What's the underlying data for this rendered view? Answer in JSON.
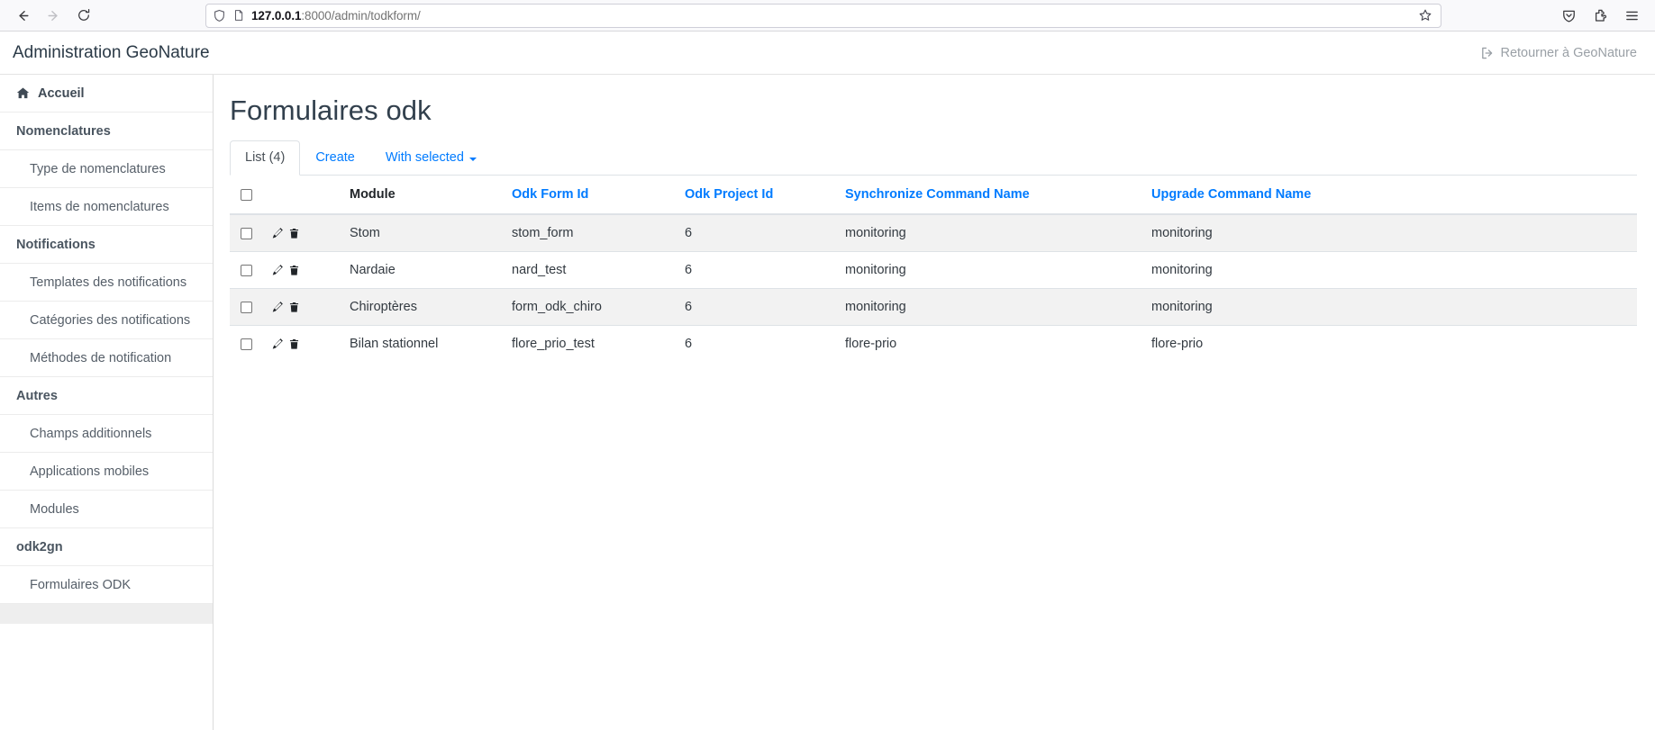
{
  "browser": {
    "back_icon": "arrow-left-icon",
    "forward_icon": "arrow-right-icon",
    "reload_icon": "reload-icon",
    "shield_icon": "shield-icon",
    "page_icon": "page-document-icon",
    "url_host": "127.0.0.1",
    "url_rest": ":8000/admin/todkform/",
    "url_full": "127.0.0.1:8000/admin/todkform/",
    "bookmark_icon": "star-icon",
    "right_icons": [
      "pocket-save-icon",
      "extensions-puzzle-icon",
      "app-menu-hamburger-icon"
    ]
  },
  "app_header": {
    "title": "Administration GeoNature",
    "return_label": "Retourner à GeoNature",
    "return_icon": "sign-out-icon"
  },
  "sidebar": {
    "items": [
      {
        "label": "Accueil",
        "type": "home",
        "icon": "home-icon"
      },
      {
        "label": "Nomenclatures",
        "type": "group"
      },
      {
        "label": "Type de nomenclatures",
        "type": "child"
      },
      {
        "label": "Items de nomenclatures",
        "type": "child"
      },
      {
        "label": "Notifications",
        "type": "group"
      },
      {
        "label": "Templates des notifications",
        "type": "child"
      },
      {
        "label": "Catégories des notifications",
        "type": "child"
      },
      {
        "label": "Méthodes de notification",
        "type": "child"
      },
      {
        "label": "Autres",
        "type": "group"
      },
      {
        "label": "Champs additionnels",
        "type": "child"
      },
      {
        "label": "Applications mobiles",
        "type": "child"
      },
      {
        "label": "Modules",
        "type": "child"
      },
      {
        "label": "odk2gn",
        "type": "group"
      },
      {
        "label": "Formulaires ODK",
        "type": "child"
      }
    ]
  },
  "main": {
    "page_title": "Formulaires odk",
    "tabs": [
      {
        "label": "List (4)",
        "active": true,
        "caret": false
      },
      {
        "label": "Create",
        "active": false,
        "caret": false
      },
      {
        "label": "With selected",
        "active": false,
        "caret": true
      }
    ],
    "table": {
      "select_all_icon": "checkbox-unchecked",
      "columns": [
        {
          "label": "",
          "key": "check"
        },
        {
          "label": "",
          "key": "ops"
        },
        {
          "label": "Module",
          "key": "module",
          "sortable": false
        },
        {
          "label": "Odk Form Id",
          "key": "odk_form_id",
          "sortable": true
        },
        {
          "label": "Odk Project Id",
          "key": "odk_project_id",
          "sortable": true
        },
        {
          "label": "Synchronize Command Name",
          "key": "sync_cmd",
          "sortable": true
        },
        {
          "label": "Upgrade Command Name",
          "key": "upgrade_cmd",
          "sortable": true
        }
      ],
      "row_icons": [
        "pencil-edit-icon",
        "trash-delete-icon"
      ],
      "rows": [
        {
          "module": "Stom",
          "odk_form_id": "stom_form",
          "odk_project_id": "6",
          "sync_cmd": "monitoring",
          "upgrade_cmd": "monitoring"
        },
        {
          "module": "Nardaie",
          "odk_form_id": "nard_test",
          "odk_project_id": "6",
          "sync_cmd": "monitoring",
          "upgrade_cmd": "monitoring"
        },
        {
          "module": "Chiroptères",
          "odk_form_id": "form_odk_chiro",
          "odk_project_id": "6",
          "sync_cmd": "monitoring",
          "upgrade_cmd": "monitoring"
        },
        {
          "module": "Bilan stationnel",
          "odk_form_id": "flore_prio_test",
          "odk_project_id": "6",
          "sync_cmd": "flore-prio",
          "upgrade_cmd": "flore-prio"
        }
      ]
    }
  },
  "colors": {
    "link_blue": "#007bff",
    "sidebar_text": "#555e68",
    "title_text": "#32404d",
    "row_stripe": "#f2f2f2"
  }
}
